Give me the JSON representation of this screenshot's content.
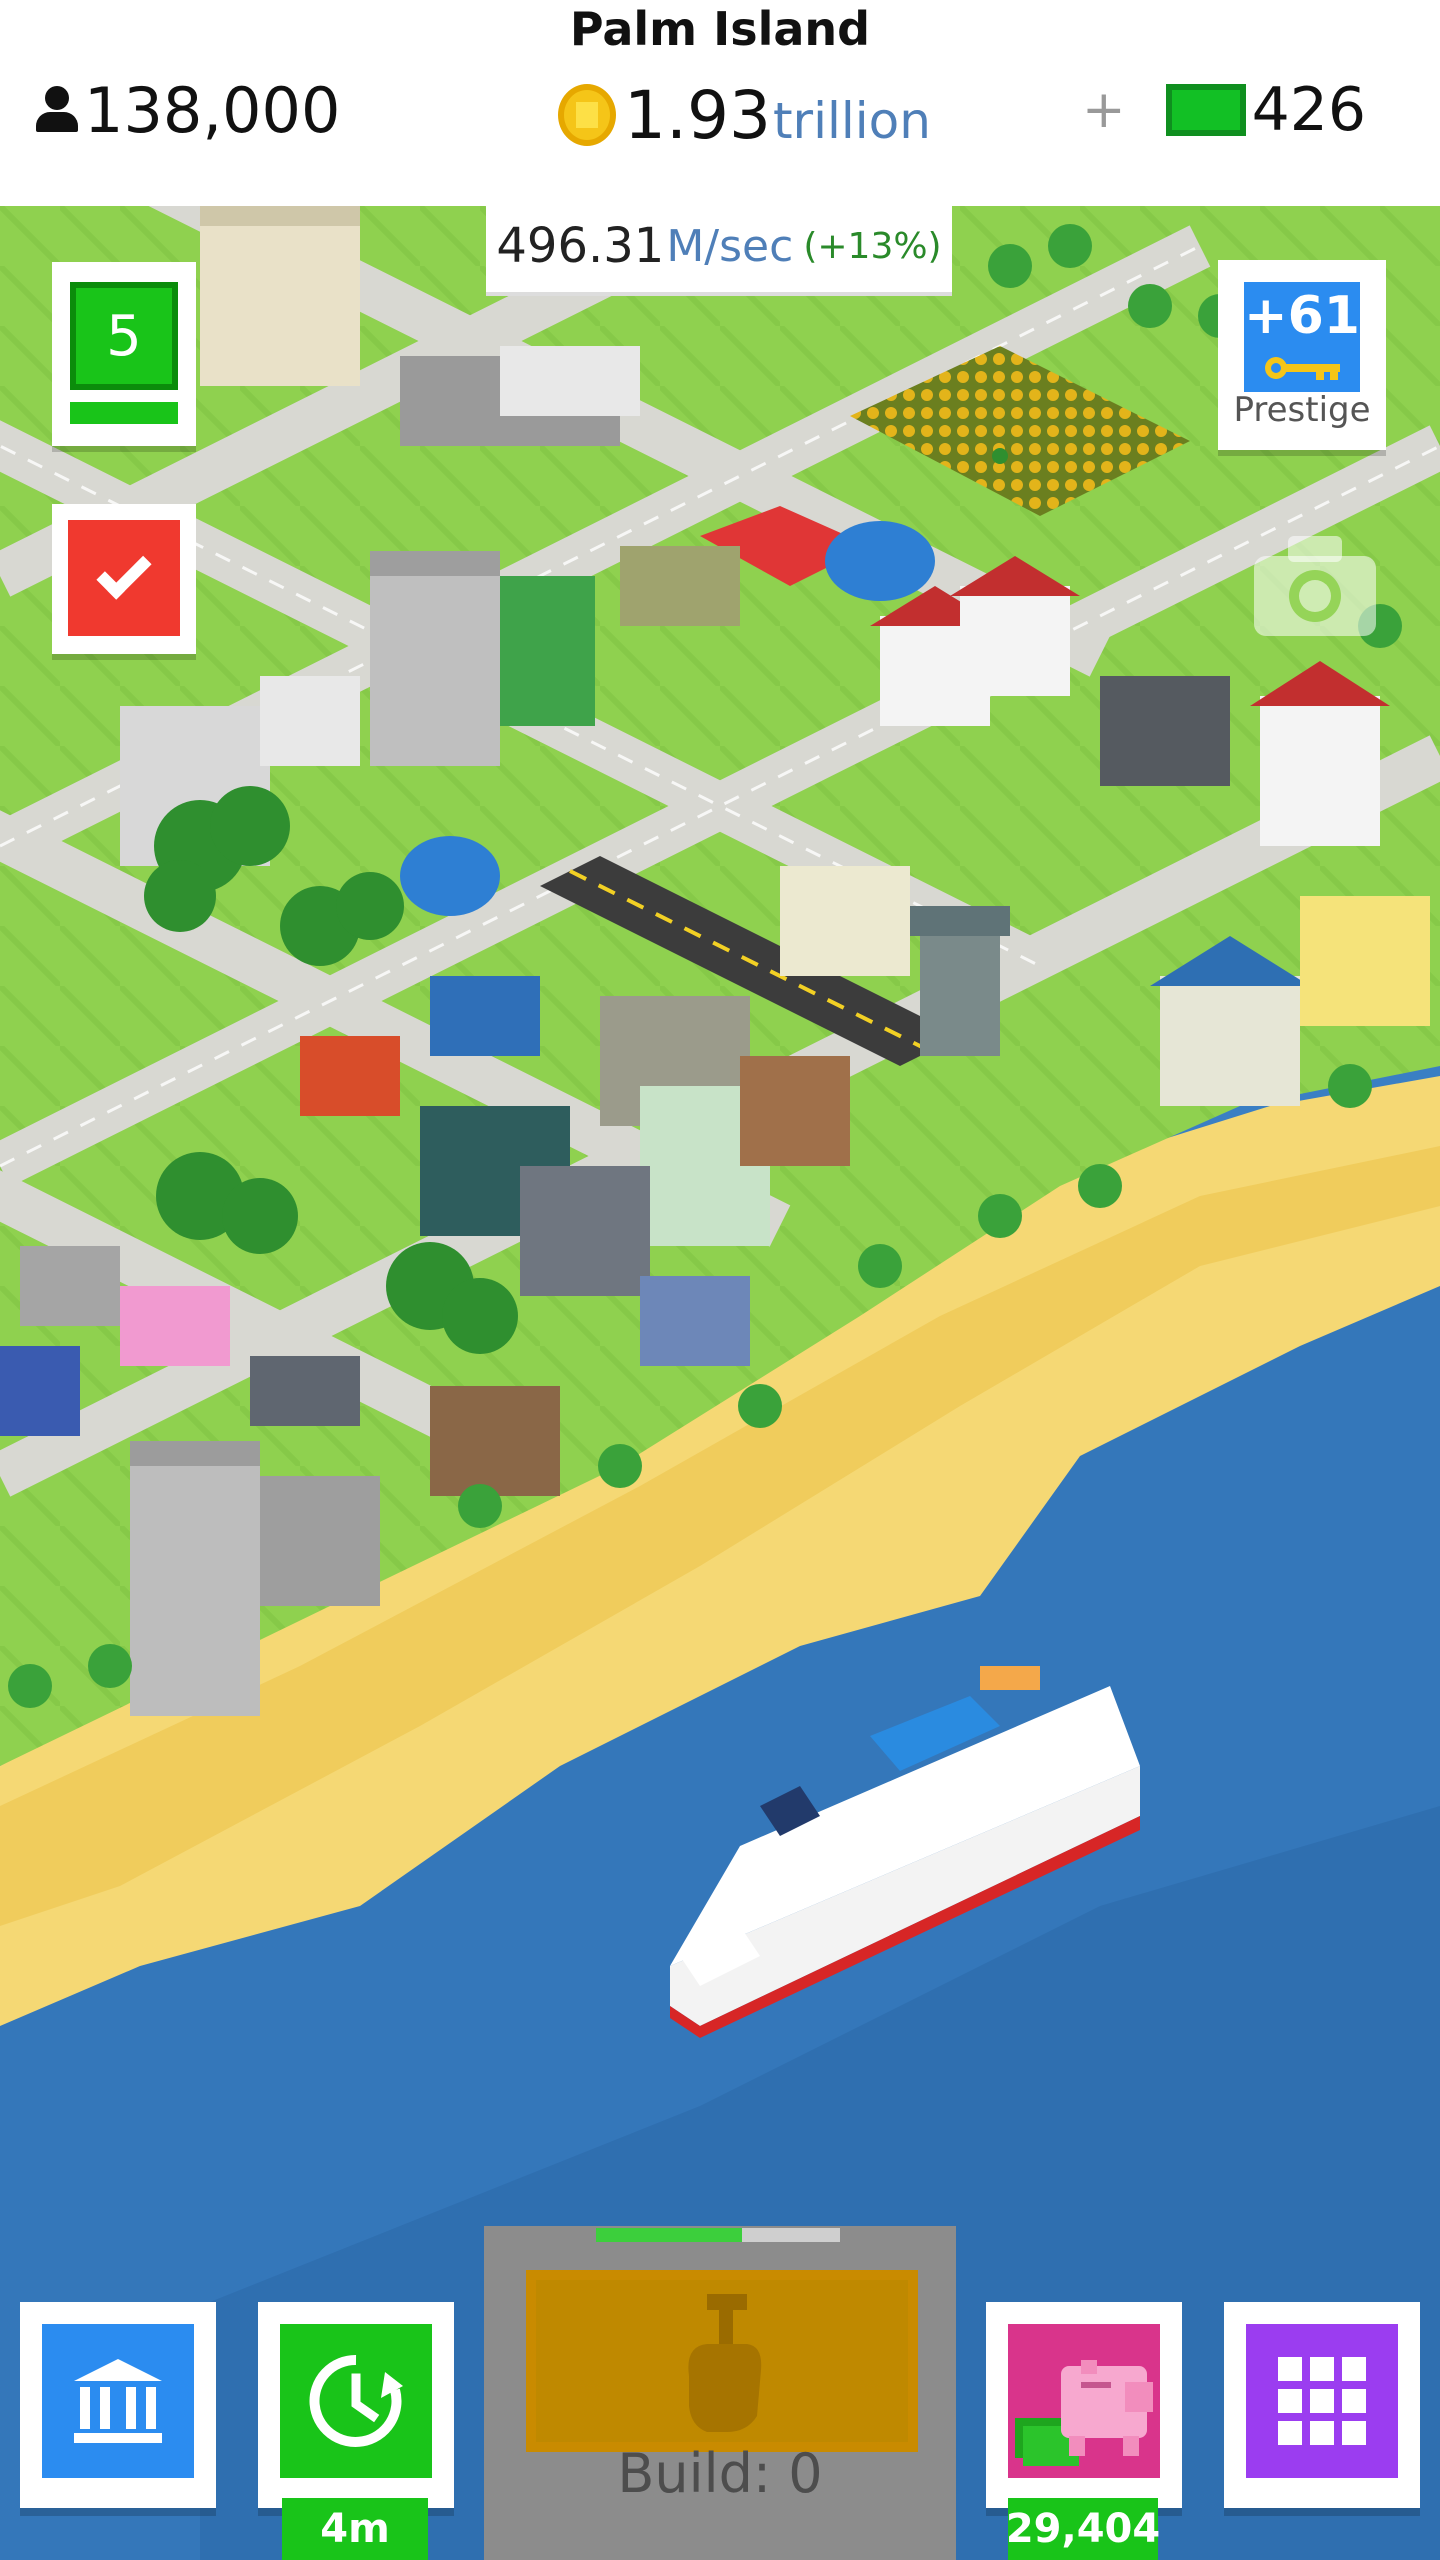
{
  "hud": {
    "island_name": "Palm Island",
    "population": "138,000",
    "coins": "1.93",
    "coins_unit": "trillion",
    "add_symbol": "+",
    "cash": "426"
  },
  "income": {
    "rate": "496.31",
    "unit": "M/sec",
    "bonus": "(+13%)"
  },
  "left_panel": {
    "level": "5"
  },
  "prestige": {
    "value": "+61",
    "label": "Prestige"
  },
  "bottom_bar": {
    "timer_label": "4m",
    "build_label": "Build: 0",
    "build_progress": 0.6,
    "piggy_bank_value": "29,404"
  },
  "icons": {
    "population": "person-icon",
    "coins": "coin-icon",
    "cash": "cash-bill-icon",
    "camera": "camera-icon",
    "bank": "bank-icon",
    "timer": "clock-refresh-icon",
    "build": "hammer-hand-icon",
    "piggy": "piggy-bank-icon",
    "grid": "grid-menu-icon",
    "tasks": "checkmark-icon",
    "prestige": "key-icon"
  },
  "colors": {
    "green": "#19c419",
    "red": "#f0392f",
    "blue": "#2b8cf0",
    "purple": "#9b3df0",
    "pink": "#d9348b",
    "ocean": "#3a7fc4",
    "sand": "#f5d874",
    "grass": "#8fd14f"
  }
}
